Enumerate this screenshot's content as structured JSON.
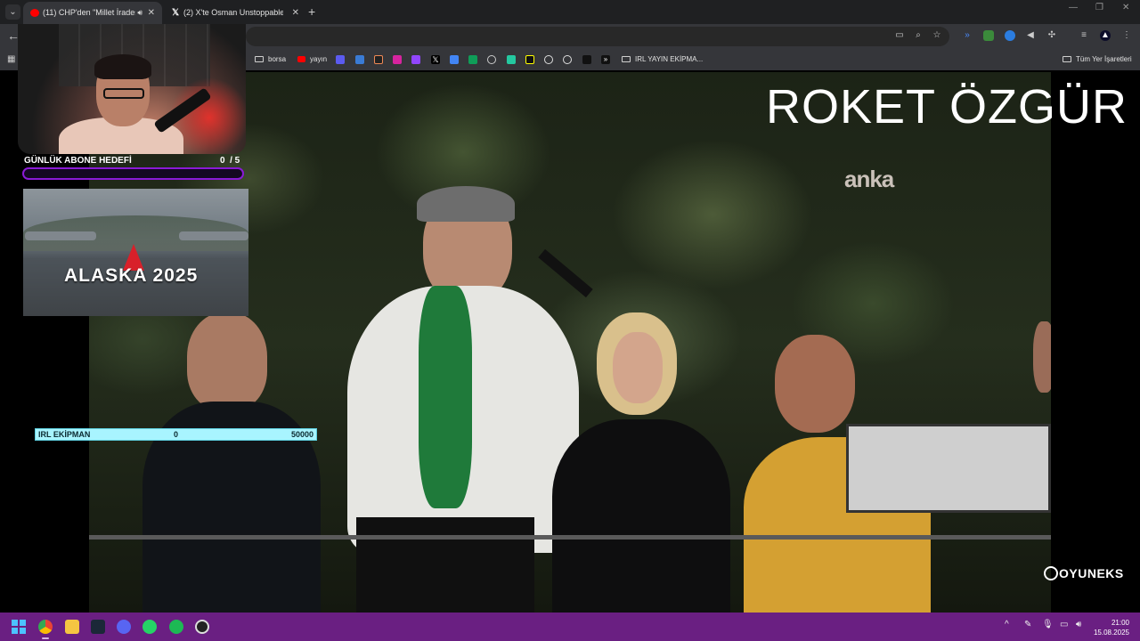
{
  "browser": {
    "tabs": [
      {
        "title": "(11) CHP'den \"Millet İradesi",
        "active": true,
        "favicon": "youtube-icon"
      },
      {
        "title": "(2) X'te Osman Unstoppable: \"",
        "active": false,
        "favicon": "x-icon"
      }
    ],
    "bookmarks": [
      "borsa",
      "yayın",
      "IRL YAYIN EKİPMA..."
    ],
    "other_bookmarks": "Tüm Yer İşaretleri"
  },
  "stream": {
    "headline": "ROKET ÖZGÜR",
    "watermark": "anka",
    "goal_label": "GÜNLÜK ABONE HEDEFİ",
    "goal_count": "0  / 5",
    "goal_progress": 0,
    "thumbnail_caption": "ALASKA 2025",
    "equipment_label": "IRL EKİPMAN",
    "equipment_current": "0",
    "equipment_target": "50000",
    "brand": "OYUNEKS"
  },
  "system": {
    "time": "21:00",
    "date": "15.08.2025"
  },
  "colors": {
    "taskbar": "#6a1f82",
    "goal_bar": "#8a1ad6",
    "equipment_bar": "#a8f4ff"
  }
}
